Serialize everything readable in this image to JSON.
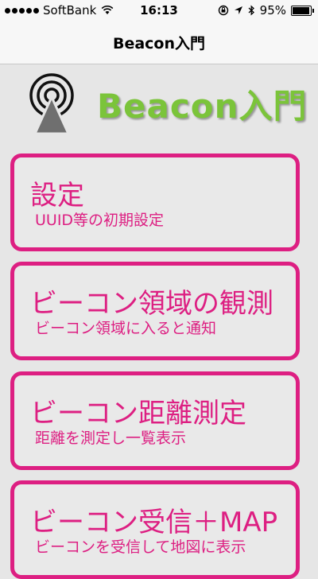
{
  "status_bar": {
    "carrier": "SoftBank",
    "time": "16:13",
    "battery_percent": "95%",
    "battery_level": 0.95
  },
  "nav": {
    "title": "Beacon入門"
  },
  "banner": {
    "brand_text": "Beacon入門",
    "icon": "beacon-antenna-icon"
  },
  "colors": {
    "accent": "#dd1f82",
    "brand_green": "#7bc43a",
    "background": "#e6e6e6"
  },
  "menu": {
    "items": [
      {
        "title": "設定",
        "subtitle": "UUID等の初期設定"
      },
      {
        "title": "ビーコン領域の観測",
        "subtitle": "ビーコン領域に入ると通知"
      },
      {
        "title": "ビーコン距離測定",
        "subtitle": "距離を測定し一覧表示"
      },
      {
        "title": "ビーコン受信＋MAP",
        "subtitle": "ビーコンを受信して地図に表示"
      }
    ]
  }
}
